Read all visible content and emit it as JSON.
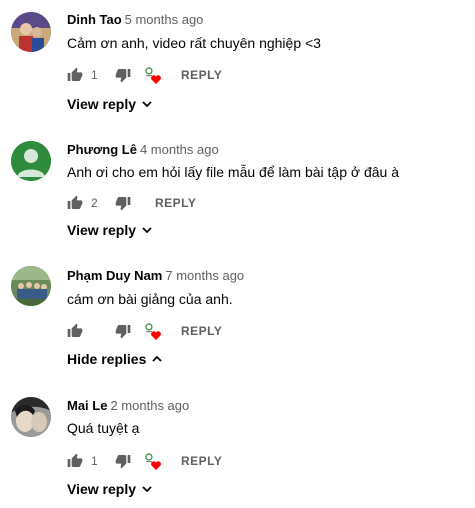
{
  "comments": [
    {
      "author": "Dinh Tao",
      "time": "5 months ago",
      "text": "Cảm ơn anh, video rất chuyên nghiệp <3",
      "likes": "1",
      "hearted": true,
      "reply_label": "REPLY",
      "toggle_label": "View reply",
      "toggle_icon": "chevron-down-icon"
    },
    {
      "author": "Phương Lê",
      "time": "4 months ago",
      "text": "Anh ơi cho em hỏi lấy file mẫu để làm bài tập ở đâu à",
      "likes": "2",
      "hearted": false,
      "reply_label": "REPLY",
      "toggle_label": "View reply",
      "toggle_icon": "chevron-down-icon"
    },
    {
      "author": "Phạm Duy Nam",
      "time": "7 months ago",
      "text": "cám ơn bài giảng của anh.",
      "likes": "",
      "hearted": true,
      "reply_label": "REPLY",
      "toggle_label": "Hide replies",
      "toggle_icon": "chevron-up-icon"
    },
    {
      "author": "Mai Le",
      "time": "2 months ago",
      "text": "Quá tuyệt ạ",
      "likes": "1",
      "hearted": true,
      "reply_label": "REPLY",
      "toggle_label": "View reply",
      "toggle_icon": "chevron-down-icon"
    }
  ],
  "colors": {
    "heart": "#ff0000",
    "icon": "#606060",
    "default_avatar_bg": "#2e8b3e"
  }
}
